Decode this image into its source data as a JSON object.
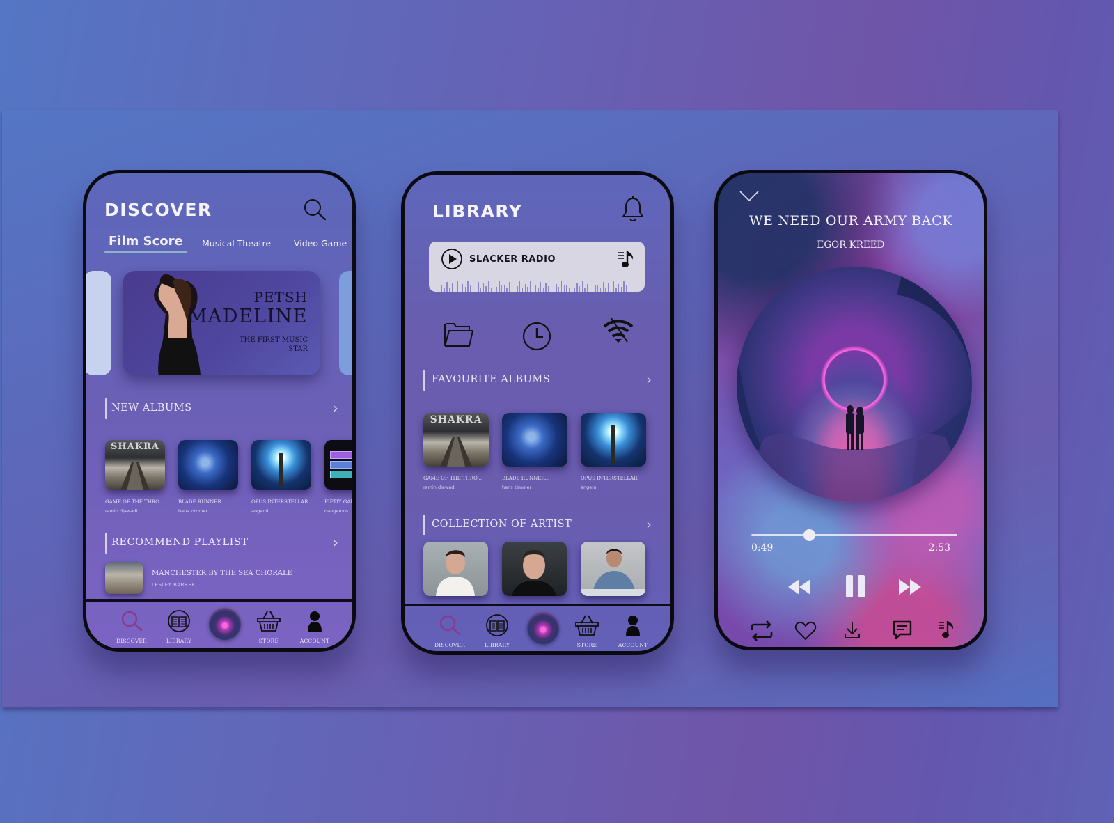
{
  "discover_screen": {
    "title": "DISCOVER",
    "search_icon": "search-icon",
    "tabs": [
      {
        "label": "Film Score",
        "active": true
      },
      {
        "label": "Musical Theatre",
        "active": false
      },
      {
        "label": "Video Game",
        "active": false
      }
    ],
    "featured": {
      "line1": "PETSH",
      "line2": "MADELINE",
      "subtitle_1": "THE FIRST MUSIC",
      "subtitle_2": "STAR"
    },
    "new_albums": {
      "heading": "NEW ALBUMS",
      "items": [
        {
          "title": "GAME OF THE THRO...",
          "artist": "ramin djawadi",
          "cover_text": "SHAKRA"
        },
        {
          "title": "BLADE RUNNER...",
          "artist": "hans zimmer",
          "cover_text": ""
        },
        {
          "title": "OPUS INTERSTELLAR",
          "artist": "angemi",
          "cover_text": ""
        },
        {
          "title": "FIFTIY GAR...",
          "artist": "dangerous",
          "cover_text": ""
        }
      ]
    },
    "recommend_playlist": {
      "heading": "RECOMMEND PLAYLIST",
      "item": {
        "title": "MANCHESTER BY THE SEA CHORALE",
        "artist": "LESLEY BARBER"
      }
    }
  },
  "library_screen": {
    "title": "LIBRARY",
    "bell_icon": "bell-icon",
    "radio": {
      "label": "SLACKER RADIO"
    },
    "quick_icons": [
      "folder-icon",
      "clock-icon",
      "wifi-off-icon"
    ],
    "favourite_albums": {
      "heading": "FAVOURITE ALBUMS",
      "items": [
        {
          "title": "GAME OF THE THRO...",
          "artist": "ramin djawadi",
          "cover_text": "SHAKRA"
        },
        {
          "title": "BLADE RUNNER...",
          "artist": "hans zimmer",
          "cover_text": ""
        },
        {
          "title": "OPUS INTERSTELLAR",
          "artist": "angemi",
          "cover_text": ""
        }
      ]
    },
    "collection": {
      "heading": "COLLECTION OF ARTIST",
      "count": 3
    }
  },
  "bottom_nav": {
    "items": [
      {
        "label": "DISCOVER",
        "icon": "search-icon"
      },
      {
        "label": "LIBRARY",
        "icon": "book-icon"
      },
      {
        "label": "",
        "icon": "now-playing-orb"
      },
      {
        "label": "STORE",
        "icon": "basket-icon"
      },
      {
        "label": "ACCOUNT",
        "icon": "user-icon"
      }
    ]
  },
  "player_screen": {
    "song_title": "WE NEED OUR ARMY BACK",
    "artist": "EGOR KREED",
    "elapsed": "0:49",
    "duration": "2:53",
    "progress_fraction": 0.28,
    "controls": [
      "rewind-icon",
      "pause-icon",
      "fast-forward-icon"
    ],
    "actions": [
      "repeat-icon",
      "heart-icon",
      "download-icon",
      "comment-icon",
      "playlist-icon"
    ]
  },
  "colors": {
    "accent_pink": "#e0407f",
    "discover_active_icon": "#8a3a8e",
    "tab_underline": "#8fb1c9"
  }
}
